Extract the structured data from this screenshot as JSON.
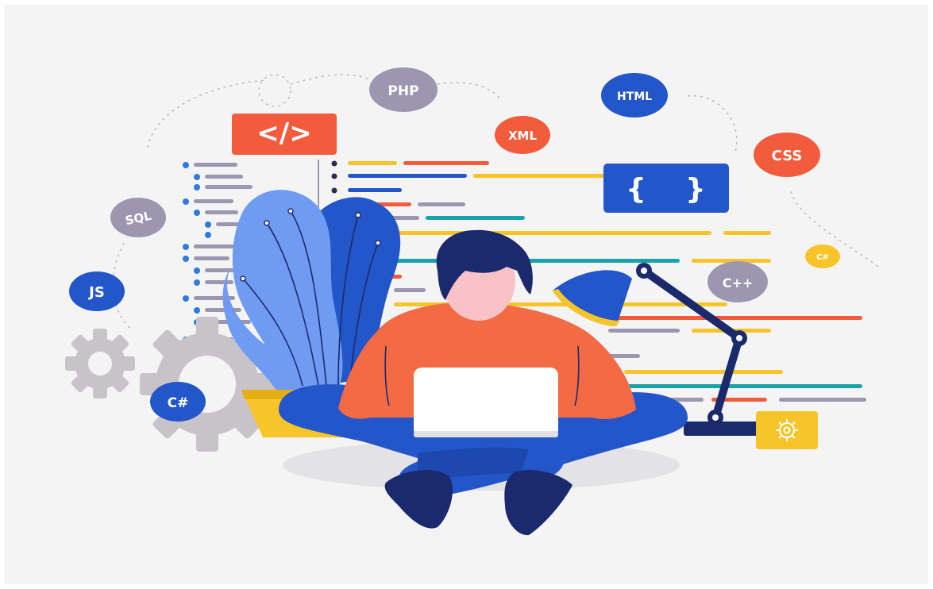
{
  "badges": {
    "php": "PHP",
    "html": "HTML",
    "xml": "XML",
    "css": "CSS",
    "sql": "SQL",
    "js": "JS",
    "csharp_small": "C#",
    "cpp": "C++",
    "csharp_large": "C#",
    "code_tag": "</>",
    "braces_open": "{",
    "braces_close": "}"
  },
  "colors": {
    "background": "#f4f4f4",
    "orange_red": "#f25c3c",
    "royal_blue": "#2356c9",
    "navy": "#1a2a6c",
    "light_blue": "#6f9cf2",
    "yellow": "#f7c52a",
    "teal": "#17a3a8",
    "lavender": "#9c96b0",
    "gray": "#c8c3c9",
    "skin": "#f8c2c6",
    "shirt": "#f36b45"
  },
  "icons": [
    "code-tag-icon",
    "braces-icon",
    "gear-icon",
    "lamp-icon",
    "laptop-icon",
    "person-icon",
    "plant-icon"
  ]
}
